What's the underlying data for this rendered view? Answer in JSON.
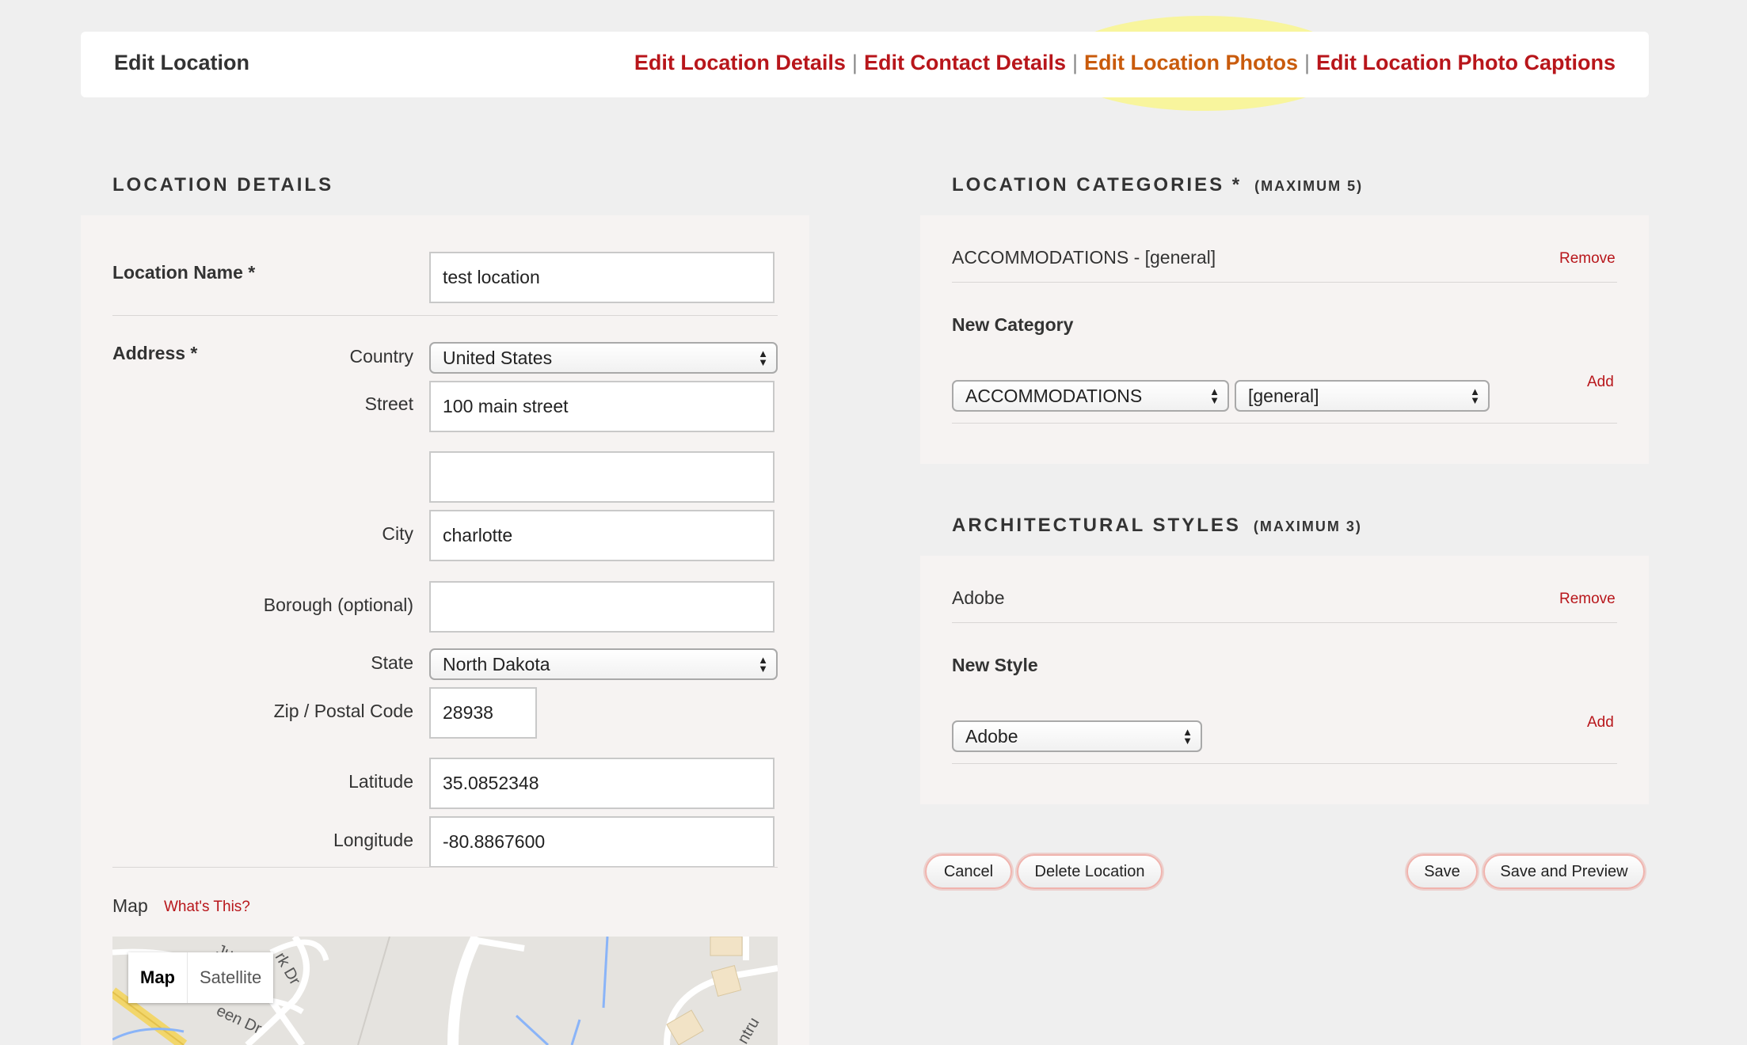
{
  "header": {
    "title": "Edit Location",
    "nav": [
      {
        "label": "Edit Location Details"
      },
      {
        "label": "Edit Contact Details"
      },
      {
        "label": "Edit Location Photos"
      },
      {
        "label": "Edit Location Photo Captions"
      }
    ],
    "separator": "|"
  },
  "location_details": {
    "section_title": "Location Details",
    "location_name_label": "Location Name *",
    "location_name_value": "test location",
    "address_label": "Address *",
    "country_label": "Country",
    "country_value": "United States",
    "street_label": "Street",
    "street_value": "100 main street",
    "street2_value": "",
    "city_label": "City",
    "city_value": "charlotte",
    "borough_label": "Borough (optional)",
    "borough_value": "",
    "state_label": "State",
    "state_value": "North Dakota",
    "zip_label": "Zip / Postal Code",
    "zip_value": "28938",
    "latitude_label": "Latitude",
    "latitude_value": "35.0852348",
    "longitude_label": "Longitude",
    "longitude_value": "-80.8867600",
    "map_label": "Map",
    "whats_this": "What's This?",
    "map_tabs": [
      "Map",
      "Satellite"
    ],
    "map_street_labels": [
      "Juani",
      "rk Dr",
      "een Dr",
      "ntru"
    ]
  },
  "categories": {
    "section_title": "Location Categories *",
    "section_sub": "(Maximum 5)",
    "existing": "ACCOMMODATIONS - [general]",
    "remove_label": "Remove",
    "new_label": "New Category",
    "select_category": "ACCOMMODATIONS",
    "select_sub": "[general]",
    "add_label": "Add"
  },
  "styles": {
    "section_title": "Architectural Styles",
    "section_sub": "(Maximum 3)",
    "existing": "Adobe",
    "remove_label": "Remove",
    "new_label": "New Style",
    "select_style": "Adobe",
    "add_label": "Add"
  },
  "actions": {
    "cancel": "Cancel",
    "delete": "Delete Location",
    "save": "Save",
    "save_preview": "Save and Preview"
  },
  "colors": {
    "accent_red": "#b8161b",
    "active_orange": "#c95b0c",
    "highlight_yellow": "#fffa5a"
  }
}
